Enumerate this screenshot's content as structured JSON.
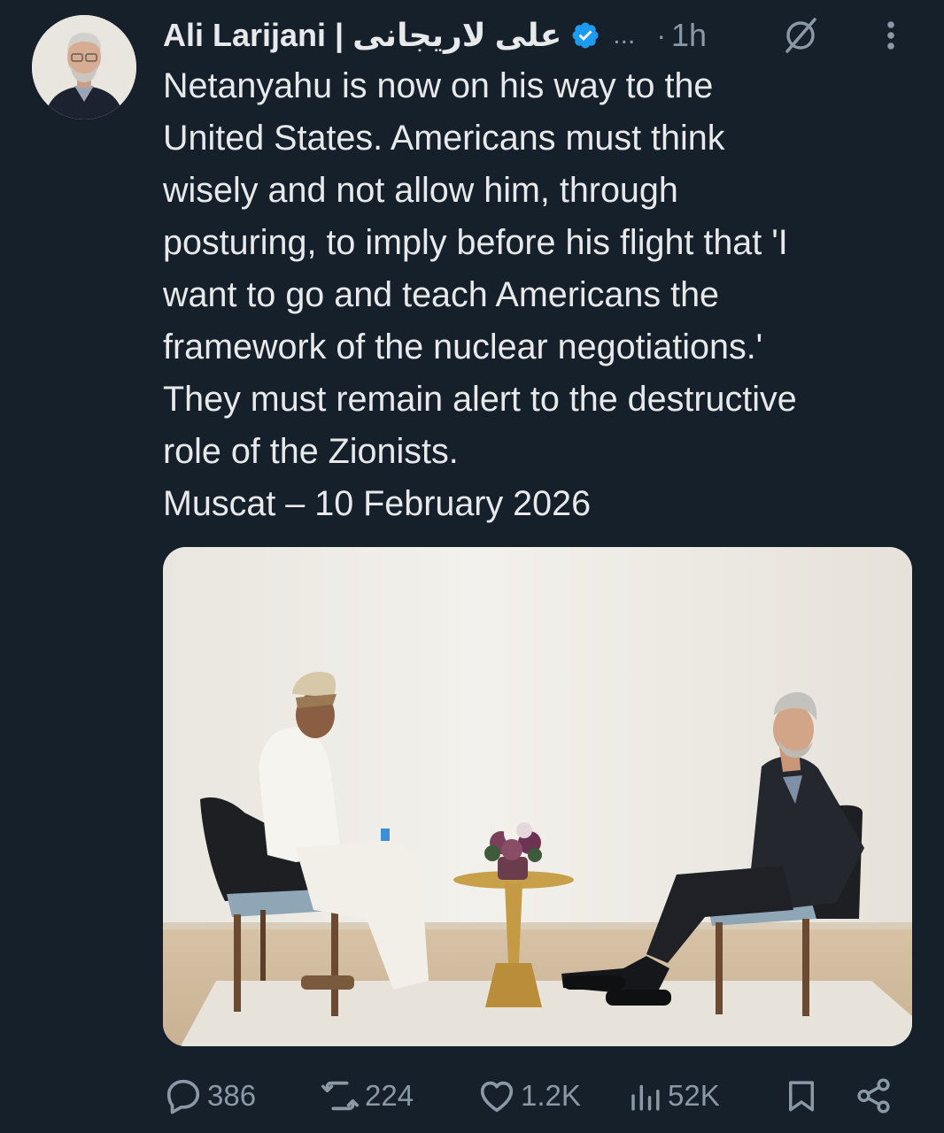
{
  "author": {
    "display_name": "Ali Larijani | علی لاریجانی",
    "handle_ellipsis": "...",
    "separator": "·",
    "timestamp": "1h"
  },
  "tweet": {
    "text": "Netanyahu is now on his way to the\nUnited States. Americans must think\nwisely and not allow him, through\nposturing, to imply before his flight that 'I\nwant to go and teach Americans the\nframework of the nuclear negotiations.'\nThey must remain alert to the destructive\nrole of the Zionists.\nMuscat – 10 February 2026"
  },
  "stats": {
    "replies": "386",
    "reposts": "224",
    "likes": "1.2K",
    "views": "52K"
  },
  "icons": {
    "verified": "verified-badge-icon",
    "grok": "grok-icon",
    "more": "more-vertical-icon",
    "reply": "reply-icon",
    "repost": "repost-icon",
    "like": "heart-icon",
    "views": "views-icon",
    "bookmark": "bookmark-icon",
    "share": "share-icon"
  },
  "colors": {
    "background": "#15202b",
    "text": "#e7e9ea",
    "muted": "#8b98a5",
    "verified": "#1d9bf0"
  }
}
